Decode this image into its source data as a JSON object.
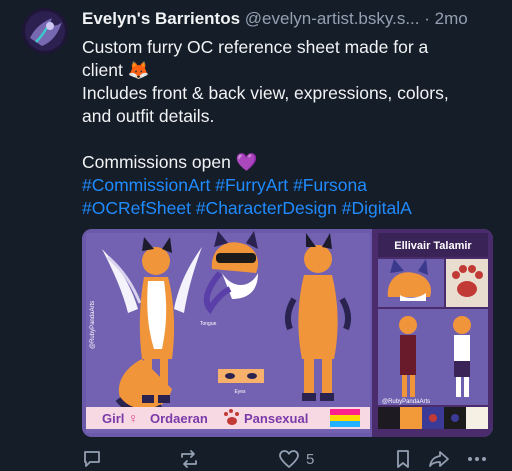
{
  "post": {
    "author": {
      "display_name": "Evelyn's Barrientos",
      "handle": "@evelyn-artist.bsky.s...",
      "separator": "·",
      "time": "2mo"
    },
    "text": {
      "line1": "Custom furry OC reference sheet made for a",
      "line2": "client 🦊",
      "line3": "Includes front & back view, expressions, colors,",
      "line4": "and outfit details.",
      "line5": "Commissions open 💜"
    },
    "hashtags_row1": [
      "#CommissionArt",
      "#FurryArt",
      "#Fursona"
    ],
    "hashtags_row2": [
      "#OCRefSheet",
      "#CharacterDesign",
      "#DigitalA"
    ],
    "image": {
      "character_name": "Ellivair Talamir",
      "tags": [
        "Girl",
        "Ordaeran",
        "Pansexual"
      ],
      "watermark": "@RubyPandaArts",
      "small_labels": {
        "tongue": "Tongue",
        "eyes": "Eyes"
      },
      "palette": [
        "#1d1b21",
        "#f29a3a",
        "#3b3a96",
        "#1b1b1b",
        "#f6efe4"
      ]
    },
    "actions": {
      "like_count": "5"
    },
    "colors": {
      "background": "#151d28",
      "link": "#208bfe",
      "muted": "#93a0b1"
    }
  }
}
